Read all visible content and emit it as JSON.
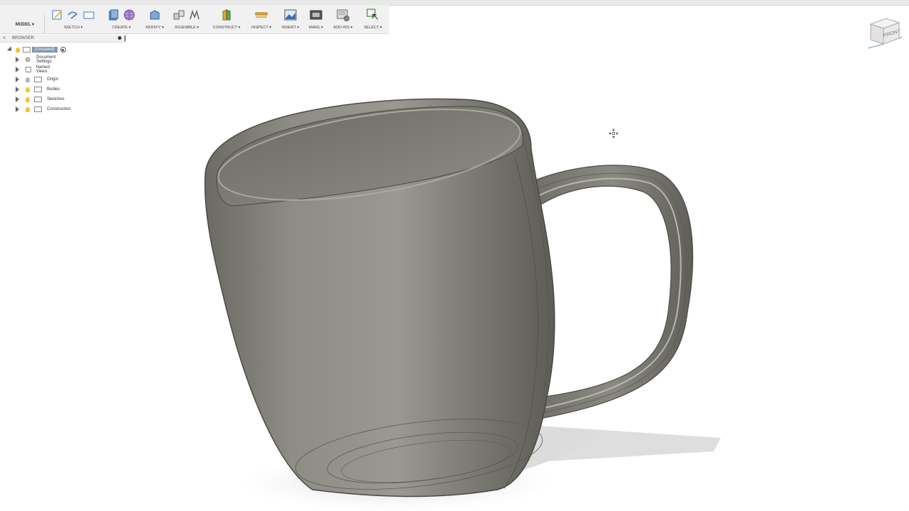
{
  "workspace": {
    "label": "MODEL ▾"
  },
  "toolbar": {
    "groups": [
      {
        "label": "SKETCH ▾"
      },
      {
        "label": "CREATE ▾"
      },
      {
        "label": "MODIFY ▾"
      },
      {
        "label": "ASSEMBLE ▾"
      },
      {
        "label": "CONSTRUCT ▾"
      },
      {
        "label": "INSPECT ▾"
      },
      {
        "label": "INSERT ▾"
      },
      {
        "label": "MAKE ▾"
      },
      {
        "label": "ADD-INS ▾"
      },
      {
        "label": "SELECT ▾"
      }
    ]
  },
  "browser": {
    "title": "BROWSER",
    "root": "(Unsaved)",
    "items": [
      {
        "label": "Document Settings",
        "icon": "gear-icon"
      },
      {
        "label": "Named Views",
        "icon": "folder-icon"
      },
      {
        "label": "Origin",
        "icon": "folder-icon"
      },
      {
        "label": "Bodies",
        "icon": "folder-icon"
      },
      {
        "label": "Sketches",
        "icon": "folder-icon"
      },
      {
        "label": "Construction",
        "icon": "folder-icon"
      }
    ]
  },
  "viewcube": {
    "face": "FRONT"
  },
  "colors": {
    "mug": "#7b7a73",
    "accent": "#3b78c4",
    "toolbar_bg": "#f1f1f1",
    "root_highlight": "#7f96b3"
  }
}
